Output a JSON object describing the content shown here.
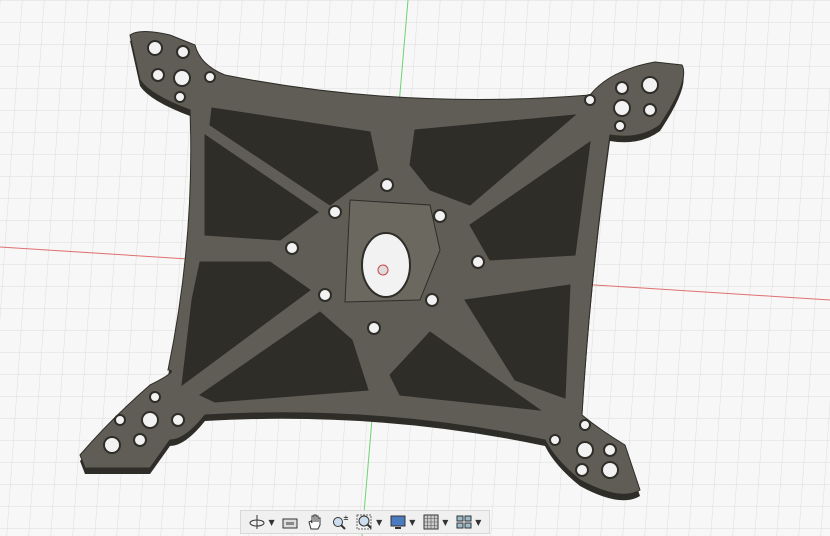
{
  "viewport": {
    "grid_color": "#dcdcdc",
    "x_axis_color": "#e07070",
    "y_axis_color": "#6fd36f",
    "model_color": "#5a584f",
    "model_edge_color": "#2e2d28"
  },
  "toolbar": {
    "items": [
      {
        "icon": "orbit-icon",
        "has_dropdown": true
      },
      {
        "icon": "look-at-icon",
        "has_dropdown": false
      },
      {
        "icon": "pan-hand-icon",
        "has_dropdown": false
      },
      {
        "icon": "zoom-icon",
        "has_dropdown": false
      },
      {
        "icon": "zoom-window-icon",
        "has_dropdown": true
      },
      {
        "icon": "display-settings-icon",
        "has_dropdown": true
      },
      {
        "icon": "grid-settings-icon",
        "has_dropdown": true
      },
      {
        "icon": "viewports-icon",
        "has_dropdown": true
      }
    ]
  }
}
